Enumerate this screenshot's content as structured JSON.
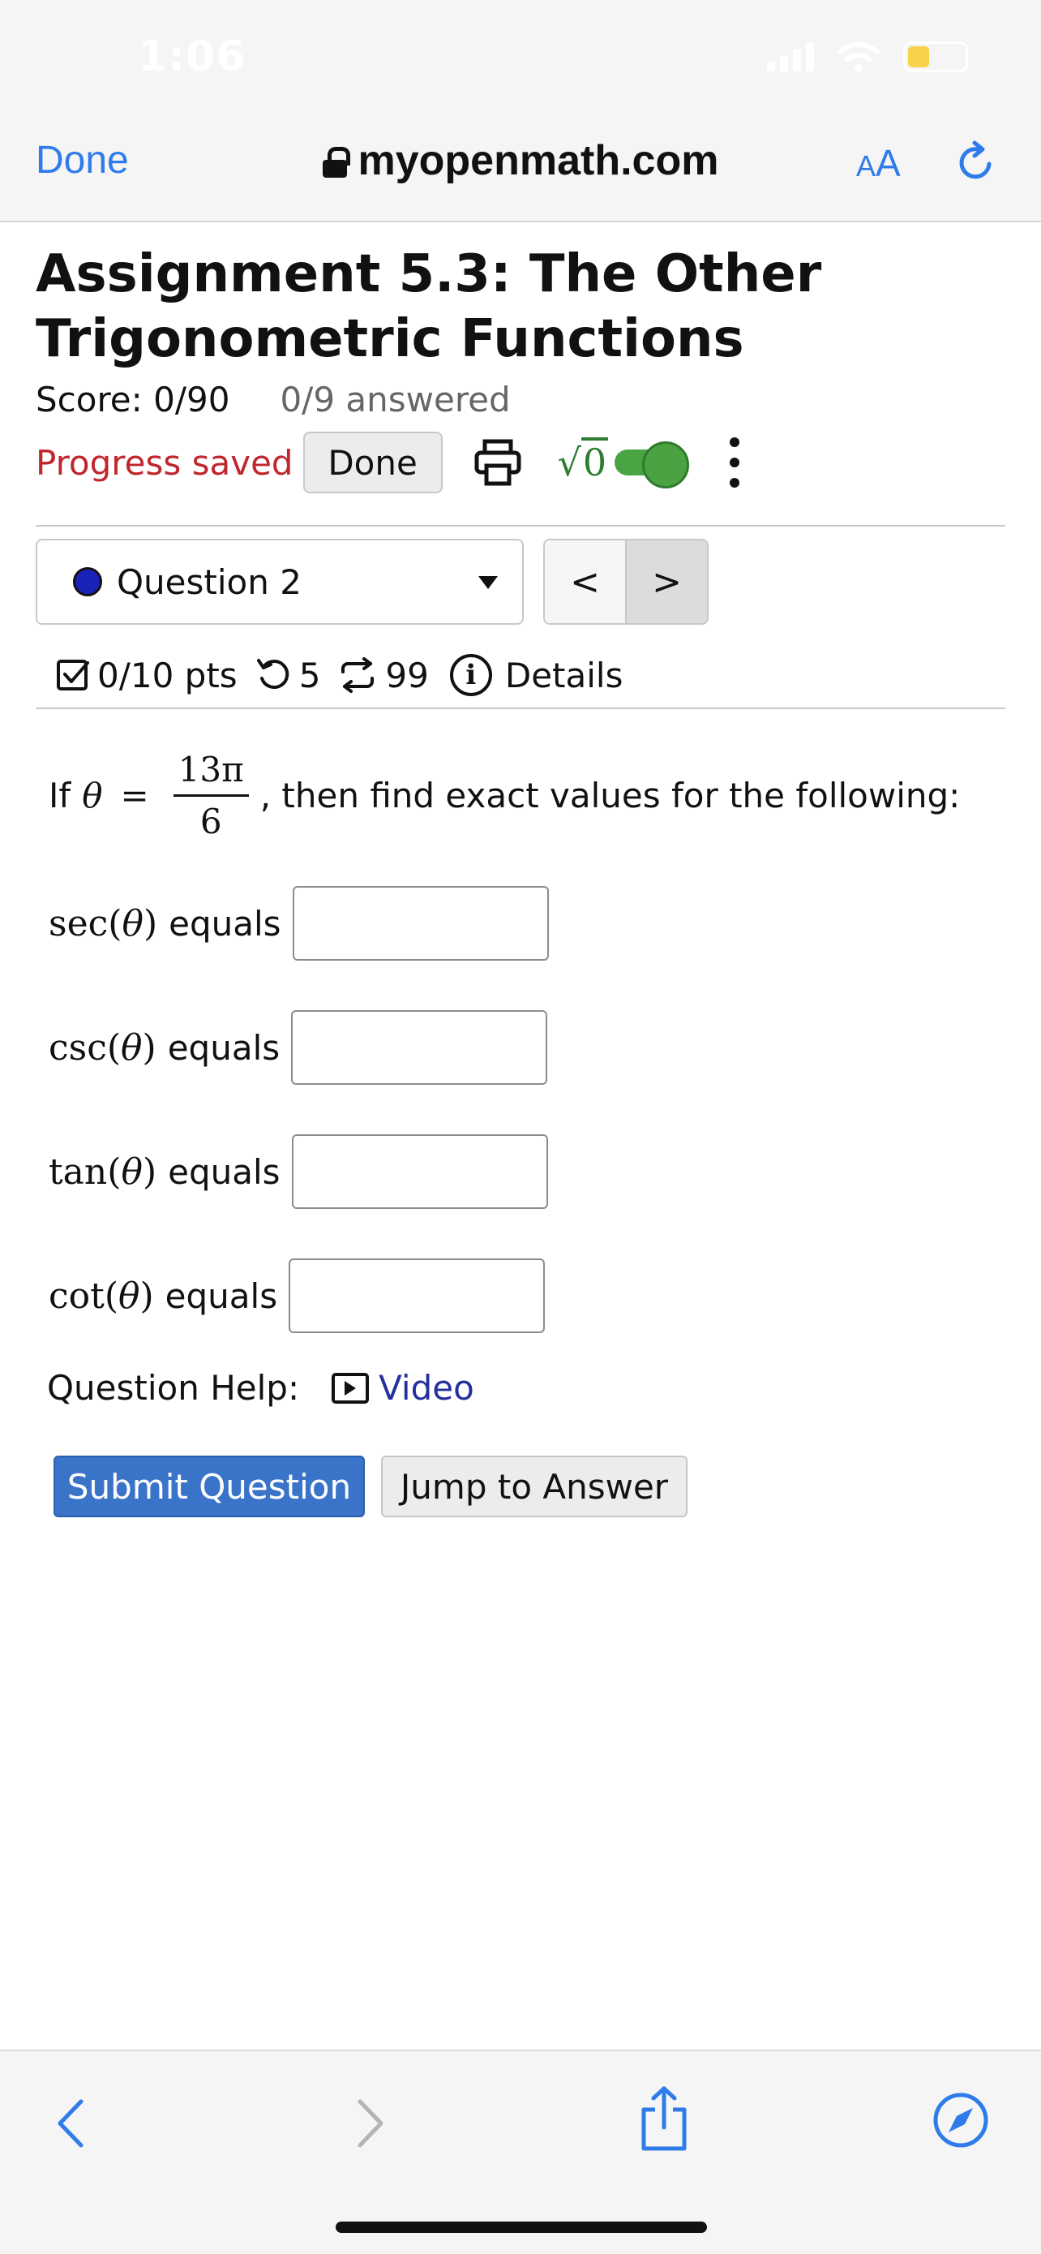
{
  "status_bar": {
    "time": "1:06"
  },
  "browser": {
    "done_label": "Done",
    "url": "myopenmath.com",
    "text_size_small": "A",
    "text_size_large": "A"
  },
  "assignment": {
    "title": "Assignment 5.3: The Other Trigonometric Functions",
    "score": "Score: 0/90",
    "answered": "0/9 answered",
    "progress_saved": "Progress saved",
    "done_button": "Done",
    "math_toggle_label": "√0"
  },
  "question_nav": {
    "selected": "Question 2",
    "prev": "<",
    "next": ">"
  },
  "question_meta": {
    "points": "0/10 pts",
    "retries": "5",
    "attempts": "99",
    "details": "Details"
  },
  "question": {
    "prompt_prefix": "If",
    "theta": "θ",
    "equals_sign": "=",
    "fraction_numerator": "13π",
    "fraction_denominator": "6",
    "prompt_suffix": ", then find exact values for the following:",
    "fields": [
      {
        "fn": "sec",
        "arg": "θ",
        "suffix": "equals",
        "value": ""
      },
      {
        "fn": "csc",
        "arg": "θ",
        "suffix": "equals",
        "value": ""
      },
      {
        "fn": "tan",
        "arg": "θ",
        "suffix": "equals",
        "value": ""
      },
      {
        "fn": "cot",
        "arg": "θ",
        "suffix": "equals",
        "value": ""
      }
    ],
    "help_label": "Question Help:",
    "video_label": "Video",
    "submit_label": "Submit Question",
    "jump_label": "Jump to Answer"
  },
  "colors": {
    "accent_blue": "#2f7bea",
    "submit_blue": "#3a74c9",
    "progress_red": "#c0262d",
    "toggle_green": "#4aa242",
    "link_purple": "#24309e"
  },
  "icons": [
    "lock-icon",
    "reload-icon",
    "print-icon",
    "kebab-icon",
    "checkbox-icon",
    "retry-icon",
    "attempts-icon",
    "info-icon",
    "video-icon",
    "back-icon",
    "forward-icon",
    "share-icon",
    "compass-icon"
  ]
}
